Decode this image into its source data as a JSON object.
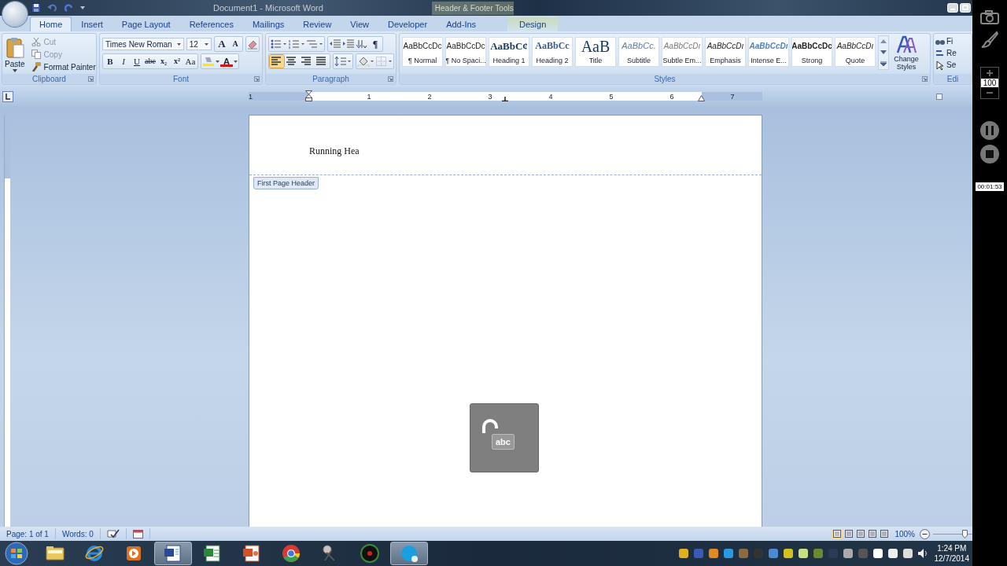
{
  "window": {
    "title": "Document1 - Microsoft Word",
    "context_title": "Header & Footer Tools"
  },
  "tabs": [
    {
      "label": "Home",
      "selected": true,
      "contextual": false
    },
    {
      "label": "Insert",
      "selected": false,
      "contextual": false
    },
    {
      "label": "Page Layout",
      "selected": false,
      "contextual": false
    },
    {
      "label": "References",
      "selected": false,
      "contextual": false
    },
    {
      "label": "Mailings",
      "selected": false,
      "contextual": false
    },
    {
      "label": "Review",
      "selected": false,
      "contextual": false
    },
    {
      "label": "View",
      "selected": false,
      "contextual": false
    },
    {
      "label": "Developer",
      "selected": false,
      "contextual": false
    },
    {
      "label": "Add-Ins",
      "selected": false,
      "contextual": false
    },
    {
      "label": "Design",
      "selected": false,
      "contextual": true
    }
  ],
  "clipboard": {
    "label": "Clipboard",
    "paste": "Paste",
    "items": [
      {
        "label": "Cut",
        "disabled": true
      },
      {
        "label": "Copy",
        "disabled": true
      },
      {
        "label": "Format Painter",
        "disabled": false
      }
    ]
  },
  "font": {
    "label": "Font",
    "face": "Times New Roman",
    "size": "12",
    "grow": "A",
    "shrink": "A",
    "format_buttons": [
      "B",
      "I",
      "U",
      "abe",
      "x₂",
      "x²",
      "Aa"
    ],
    "color_button": "A"
  },
  "paragraph": {
    "label": "Paragraph",
    "pilcrow": "¶",
    "alignments": [
      {
        "selected": true
      },
      {
        "selected": false
      },
      {
        "selected": false
      },
      {
        "selected": false
      }
    ]
  },
  "styles": {
    "label": "Styles",
    "change_styles": "Change Styles",
    "items": [
      {
        "sample": "AaBbCcDc",
        "name": "¶ Normal",
        "kind": "plain"
      },
      {
        "sample": "AaBbCcDc",
        "name": "¶ No Spaci...",
        "kind": "plain"
      },
      {
        "sample": "AaBbC¢",
        "name": "Heading 1",
        "kind": "heading1"
      },
      {
        "sample": "AaBbCc",
        "name": "Heading 2",
        "kind": "heading2"
      },
      {
        "sample": "AaB",
        "name": "Title",
        "kind": "title"
      },
      {
        "sample": "AaBbCc.",
        "name": "Subtitle",
        "kind": "subtitle"
      },
      {
        "sample": "AaBbCcDı",
        "name": "Subtle Em...",
        "kind": "subtle"
      },
      {
        "sample": "AaBbCcDı",
        "name": "Emphasis",
        "kind": "emphasis"
      },
      {
        "sample": "AaBbCcDı",
        "name": "Intense E...",
        "kind": "intense"
      },
      {
        "sample": "AaBbCcDc",
        "name": "Strong",
        "kind": "strong"
      },
      {
        "sample": "AaBbCcDı",
        "name": "Quote",
        "kind": "emphasis"
      }
    ]
  },
  "editing": {
    "label": "Edi",
    "items": [
      "Fi",
      "Re",
      "Se"
    ]
  },
  "ruler": {
    "labels": [
      "1",
      "1",
      "2",
      "3",
      "4",
      "5",
      "6",
      "7"
    ]
  },
  "document": {
    "header_text": "Running Hea",
    "header_tab": "First Page Header",
    "overlay_badge": "abc"
  },
  "status_bar": {
    "page": "Page: 1 of 1",
    "words": "Words: 0",
    "zoom": "100%",
    "zoom_slider": {
      "level": 0.85
    }
  },
  "taskbar": {
    "apps": [
      {
        "kind": "folder",
        "selected": false
      },
      {
        "kind": "ie",
        "selected": false
      },
      {
        "kind": "media",
        "selected": false
      },
      {
        "kind": "word",
        "selected": true
      },
      {
        "kind": "excel",
        "selected": false
      },
      {
        "kind": "powerpoint",
        "selected": false
      },
      {
        "kind": "chrome",
        "selected": false
      },
      {
        "kind": "tool",
        "selected": false
      },
      {
        "kind": "recorder",
        "selected": false
      },
      {
        "kind": "skype",
        "selected": true
      }
    ],
    "time": "1:24 PM",
    "date": "12/7/2014"
  },
  "recorder": {
    "zoom": "100",
    "timer": "00:01:53"
  }
}
